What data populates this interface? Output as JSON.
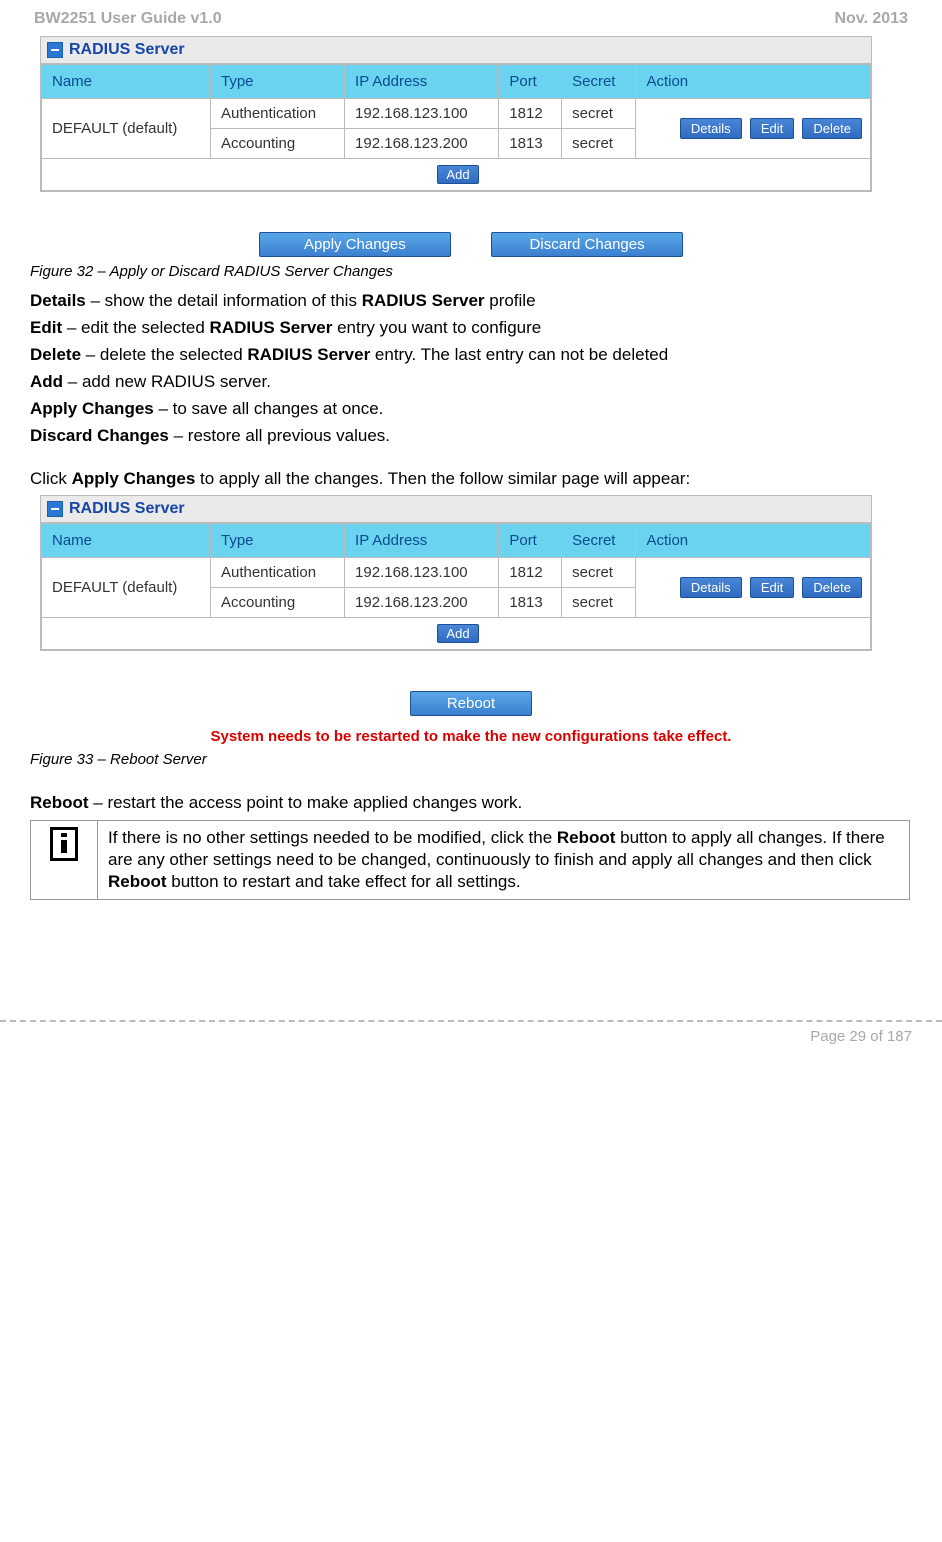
{
  "header": {
    "left": "BW2251 User Guide v1.0",
    "right": "Nov.  2013"
  },
  "panel": {
    "title": "RADIUS Server",
    "columns": [
      "Name",
      "Type",
      "IP Address",
      "Port",
      "Secret",
      "Action"
    ],
    "name_cell": "DEFAULT (default)",
    "rows": [
      {
        "type": "Authentication",
        "ip": "192.168.123.100",
        "port": "1812",
        "secret": "secret"
      },
      {
        "type": "Accounting",
        "ip": "192.168.123.200",
        "port": "1813",
        "secret": "secret"
      }
    ],
    "action_buttons": [
      "Details",
      "Edit",
      "Delete"
    ],
    "add_label": "Add"
  },
  "apply_buttons": {
    "apply": "Apply Changes",
    "discard": "Discard Changes"
  },
  "captions": {
    "fig32": "Figure 32 – Apply or Discard RADIUS Server Changes",
    "fig33": "Figure 33 – Reboot Server"
  },
  "defs": {
    "details": {
      "term": "Details",
      "text": " – show the detail information of this ",
      "term2": "RADIUS Server",
      "tail": " profile"
    },
    "edit": {
      "term": "Edit",
      "text": " – edit the selected ",
      "term2": "RADIUS Server",
      "tail": " entry you want to configure"
    },
    "delete": {
      "term": "Delete",
      "text": " – delete the selected ",
      "term2": "RADIUS Server",
      "tail": " entry. The last entry can not be deleted"
    },
    "add": {
      "term": "Add",
      "text": " – add new RADIUS server."
    },
    "apply": {
      "term": "Apply Changes",
      "text": " – to save all changes at once."
    },
    "discard": {
      "term": "Discard Changes",
      "text": " – restore all previous values."
    }
  },
  "click_line": {
    "pre": "Click ",
    "bold": "Apply Changes",
    "post": " to apply all the changes. Then the follow similar page will appear:"
  },
  "reboot_btn": "Reboot",
  "sys_msg": "System needs to be restarted to make the new configurations take effect.",
  "reboot_def": {
    "term": "Reboot",
    "text": " – restart the access point to make applied changes work."
  },
  "info_box": {
    "p1a": "If there is no other settings needed to be modified, click the ",
    "p1b": "Reboot",
    "p1c": " button to apply all changes. If there are any other settings need to be changed, continuously to finish and apply all changes and then click ",
    "p1d": "Reboot",
    "p1e": " button to restart and take effect for all settings."
  },
  "footer": "Page 29 of 187"
}
